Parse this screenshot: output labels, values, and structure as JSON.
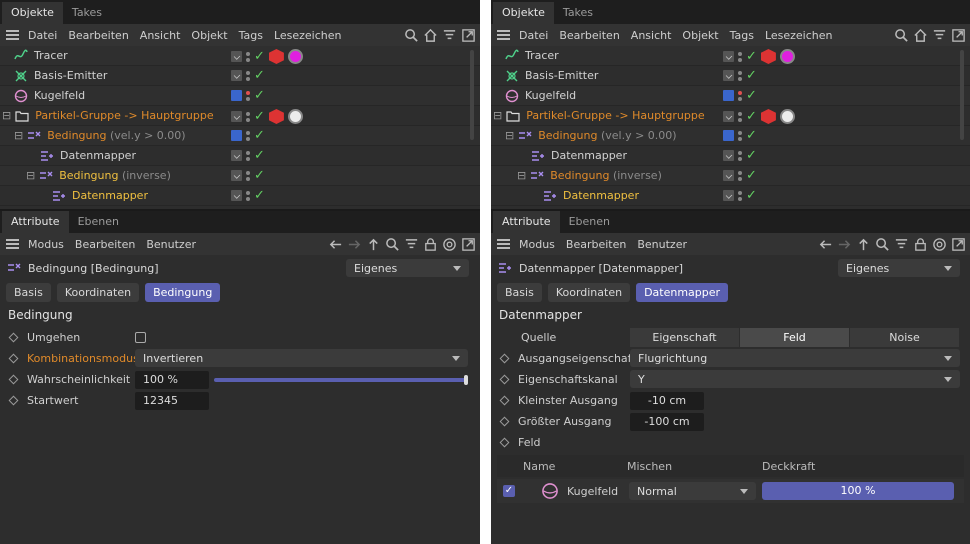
{
  "left": {
    "top_tabs": [
      "Objekte",
      "Takes"
    ],
    "menu": [
      "Datei",
      "Bearbeiten",
      "Ansicht",
      "Objekt",
      "Tags",
      "Lesezeichen"
    ],
    "objects": [
      {
        "name": "Tracer",
        "sub": "",
        "color": "white"
      },
      {
        "name": "Basis-Emitter",
        "sub": "",
        "color": "white"
      },
      {
        "name": "Kugelfeld",
        "sub": "",
        "color": "white"
      },
      {
        "name": "Partikel-Gruppe -> Hauptgruppe",
        "sub": "",
        "color": "orange"
      },
      {
        "name": "Bedingung",
        "sub": " (vel.y > 0.00)",
        "color": "orange"
      },
      {
        "name": "Datenmapper",
        "sub": "",
        "color": "white"
      },
      {
        "name": "Bedingung",
        "sub": " (inverse)",
        "color": "yellow"
      },
      {
        "name": "Datenmapper",
        "sub": "",
        "color": "yellow"
      }
    ],
    "attr_tabs": [
      "Attribute",
      "Ebenen"
    ],
    "attr_menu": [
      "Modus",
      "Bearbeiten",
      "Benutzer"
    ],
    "header_title": "Bedingung [Bedingung]",
    "header_mode": "Eigenes",
    "sub_tabs": [
      "Basis",
      "Koordinaten",
      "Bedingung"
    ],
    "section": "Bedingung",
    "props": {
      "umgehen": "Umgehen",
      "kombi_label": "Kombinationsmodus",
      "kombi_value": "Invertieren",
      "wahr_label": "Wahrscheinlichkeit",
      "wahr_value": "100 %",
      "wahr_fraction": 1.0,
      "start_label": "Startwert",
      "start_value": "12345"
    }
  },
  "right": {
    "top_tabs": [
      "Objekte",
      "Takes"
    ],
    "menu": [
      "Datei",
      "Bearbeiten",
      "Ansicht",
      "Objekt",
      "Tags",
      "Lesezeichen"
    ],
    "objects": [
      {
        "name": "Tracer",
        "sub": "",
        "color": "white"
      },
      {
        "name": "Basis-Emitter",
        "sub": "",
        "color": "white"
      },
      {
        "name": "Kugelfeld",
        "sub": "",
        "color": "white"
      },
      {
        "name": "Partikel-Gruppe -> Hauptgruppe",
        "sub": "",
        "color": "orange"
      },
      {
        "name": "Bedingung",
        "sub": " (vel.y > 0.00)",
        "color": "orange"
      },
      {
        "name": "Datenmapper",
        "sub": "",
        "color": "white"
      },
      {
        "name": "Bedingung",
        "sub": " (inverse)",
        "color": "orange"
      },
      {
        "name": "Datenmapper",
        "sub": "",
        "color": "yellow"
      }
    ],
    "attr_tabs": [
      "Attribute",
      "Ebenen"
    ],
    "attr_menu": [
      "Modus",
      "Bearbeiten",
      "Benutzer"
    ],
    "header_title": "Datenmapper [Datenmapper]",
    "header_mode": "Eigenes",
    "sub_tabs": [
      "Basis",
      "Koordinaten",
      "Datenmapper"
    ],
    "section": "Datenmapper",
    "quelle_label": "Quelle",
    "quelle_options": [
      "Eigenschaft",
      "Feld",
      "Noise"
    ],
    "props": {
      "ausgang_label": "Ausgangseigenschaft",
      "ausgang_value": "Flugrichtung",
      "kanal_label": "Eigenschaftskanal",
      "kanal_value": "Y",
      "klein_label": "Kleinster Ausgang",
      "klein_value": "-10 cm",
      "gross_label": "Größter Ausgang",
      "gross_value": "-100 cm",
      "feld_label": "Feld"
    },
    "field_table": {
      "headers": [
        "Name",
        "Mischen",
        "Deckkraft"
      ],
      "row_name": "Kugelfeld",
      "row_mix": "Normal",
      "row_opacity": "100 %"
    }
  },
  "colors": {
    "accent": "#5a5fb0",
    "orange": "#e08a2a",
    "yellow": "#f0c040",
    "check": "#63d163"
  }
}
